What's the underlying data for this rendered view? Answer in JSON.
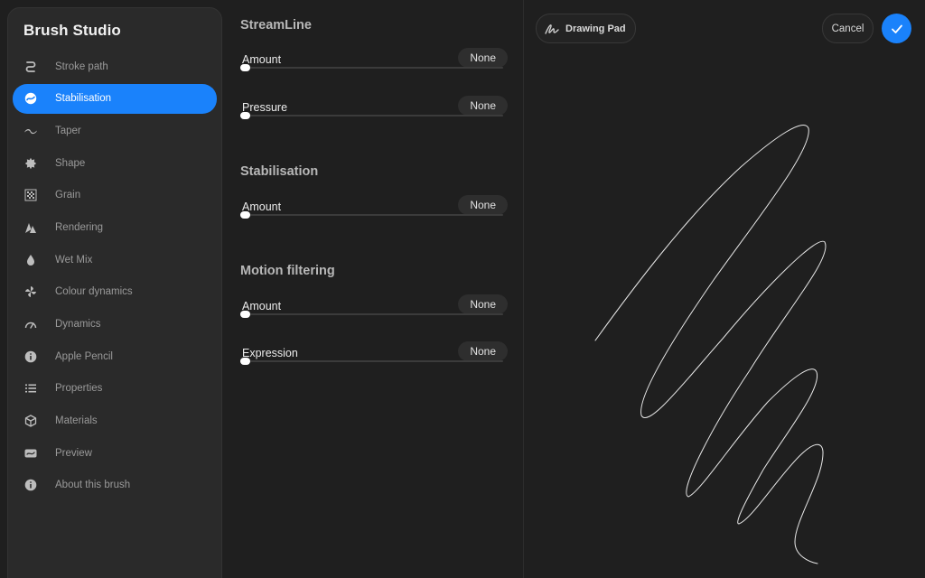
{
  "sidebar": {
    "title": "Brush Studio",
    "items": [
      {
        "label": "Stroke path",
        "icon": "stroke-path-icon"
      },
      {
        "label": "Stabilisation",
        "icon": "stabilisation-icon",
        "active": true
      },
      {
        "label": "Taper",
        "icon": "taper-icon"
      },
      {
        "label": "Shape",
        "icon": "shape-icon"
      },
      {
        "label": "Grain",
        "icon": "grain-icon"
      },
      {
        "label": "Rendering",
        "icon": "rendering-icon"
      },
      {
        "label": "Wet Mix",
        "icon": "wet-mix-icon"
      },
      {
        "label": "Colour dynamics",
        "icon": "colour-dynamics-icon"
      },
      {
        "label": "Dynamics",
        "icon": "dynamics-icon"
      },
      {
        "label": "Apple Pencil",
        "icon": "apple-pencil-icon"
      },
      {
        "label": "Properties",
        "icon": "properties-icon"
      },
      {
        "label": "Materials",
        "icon": "materials-icon"
      },
      {
        "label": "Preview",
        "icon": "preview-icon"
      },
      {
        "label": "About this brush",
        "icon": "about-icon"
      }
    ]
  },
  "sections": {
    "streamline": {
      "title": "StreamLine",
      "amount": {
        "label": "Amount",
        "value": "None",
        "level": 0
      },
      "pressure": {
        "label": "Pressure",
        "value": "None",
        "level": 0
      }
    },
    "stabilisation": {
      "title": "Stabilisation",
      "amount": {
        "label": "Amount",
        "value": "None",
        "level": 0
      }
    },
    "motion_filtering": {
      "title": "Motion filtering",
      "amount": {
        "label": "Amount",
        "value": "None",
        "level": 0
      },
      "expression": {
        "label": "Expression",
        "value": "None",
        "level": 0
      }
    }
  },
  "toolbar": {
    "drawing_pad_label": "Drawing Pad",
    "cancel_label": "Cancel",
    "done_icon": "checkmark-icon"
  },
  "colors": {
    "accent": "#1a82fb",
    "background": "#1f1f1f",
    "sidebar": "#2a2a2a",
    "stroke": "#e8e8e8"
  }
}
